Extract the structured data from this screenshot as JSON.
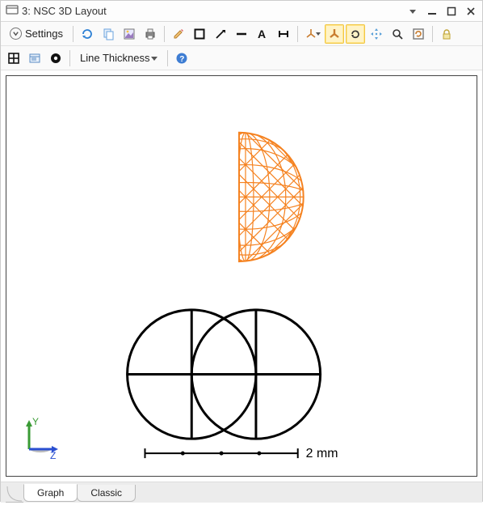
{
  "window": {
    "title": "3: NSC 3D Layout"
  },
  "toolbar1": {
    "settings_label": "Settings"
  },
  "toolbar2": {
    "line_thickness_label": "Line Thickness"
  },
  "viewport": {
    "axis": {
      "y_label": "Y",
      "z_label": "Z"
    },
    "scale_label": "2 mm"
  },
  "tabs": {
    "items": [
      {
        "label": "Graph",
        "active": true
      },
      {
        "label": "Classic",
        "active": false
      }
    ]
  },
  "colors": {
    "accent_orange": "#f58220",
    "toolbar_highlight": "#fff3c7",
    "axis_y": "#3a9b35",
    "axis_z": "#2a4fd1",
    "axis_x_shadow": "#9a9a9a"
  }
}
